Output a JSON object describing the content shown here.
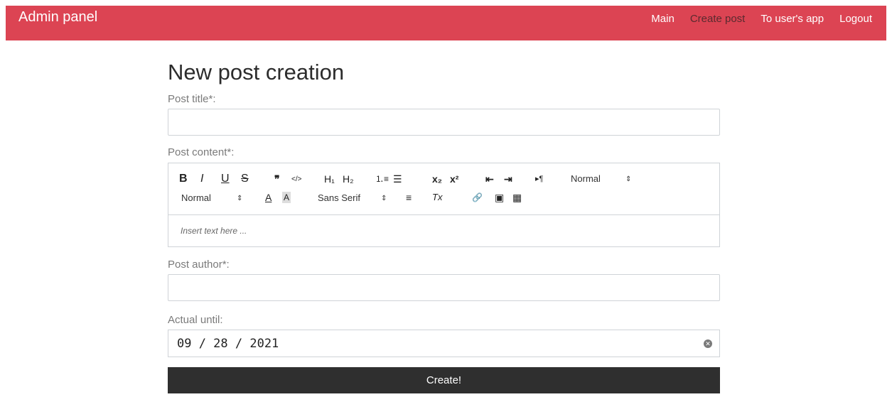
{
  "nav": {
    "brand": "Admin panel",
    "links": [
      {
        "label": "Main"
      },
      {
        "label": "Create post"
      },
      {
        "label": "To user's app"
      },
      {
        "label": "Logout"
      }
    ],
    "active_link": "Create post"
  },
  "page": {
    "title": "New post creation"
  },
  "form": {
    "title_label": "Post title*:",
    "title_value": "",
    "content_label": "Post content*:",
    "content_placeholder": "Insert text here ...",
    "author_label": "Post author*:",
    "author_value": "",
    "actual_until_label": "Actual until:",
    "actual_until_value": "09 / 28 / 2021",
    "submit_label": "Create!"
  },
  "toolbar": {
    "bold": "B",
    "italic": "I",
    "underline": "U",
    "strike": "S",
    "blockquote": "❞",
    "code": "</>",
    "h1": "H₁",
    "h2": "H₂",
    "ordered_list": "⒈≡",
    "bullet_list": "☰",
    "subscript": "x₂",
    "superscript": "x²",
    "outdent": "⇤",
    "indent": "⇥",
    "rtl": "▸¶",
    "header_select": "Normal",
    "size_select": "Normal",
    "color": "A",
    "background": "A",
    "font_select": "Sans Serif",
    "align": "≡",
    "clean": "Tx",
    "link": "🔗",
    "image": "▣",
    "video": "▦",
    "select_arrow": "⇕"
  },
  "colors": {
    "navbar": "#dc4453",
    "active_link": "#5a2a2f",
    "button": "#2f2f2f"
  }
}
